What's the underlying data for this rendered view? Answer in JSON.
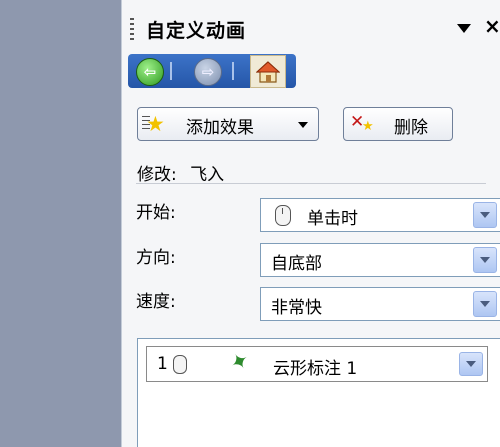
{
  "panel": {
    "title": "自定义动画"
  },
  "toolbar": {
    "add_effect_label": "添加效果",
    "delete_label": "删除"
  },
  "modify": {
    "label": "修改:",
    "effect": "飞入"
  },
  "settings": {
    "start_label": "开始:",
    "start_value": "单击时",
    "direction_label": "方向:",
    "direction_value": "自底部",
    "speed_label": "速度:",
    "speed_value": "非常快"
  },
  "animation_list": {
    "items": [
      {
        "index": "1",
        "name": "云形标注 1"
      }
    ]
  },
  "colors": {
    "nav_bar": "#2f62b8",
    "back_button": "#3aa629",
    "pane_background": "#f5f6f8",
    "desktop_background": "#8e98ae"
  },
  "icons": {
    "back": "back-arrow-icon",
    "forward": "forward-arrow-icon",
    "home": "home-icon",
    "add_effect": "star-icon",
    "delete": "delete-x-icon",
    "trigger": "mouse-icon",
    "effect": "green-star-pin-icon"
  }
}
